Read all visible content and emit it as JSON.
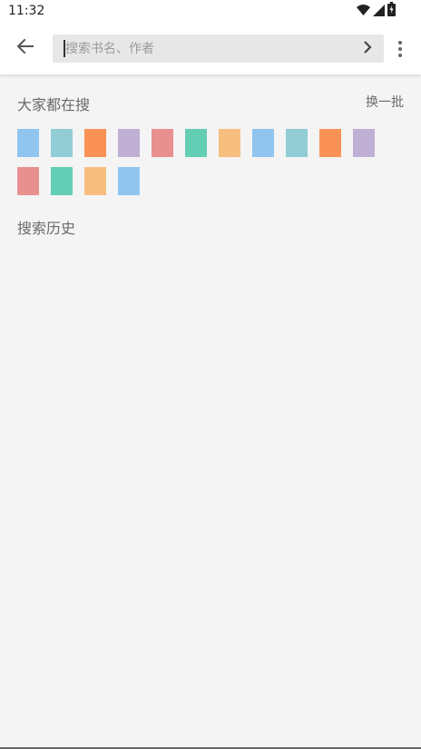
{
  "status_bar": {
    "time": "11:32",
    "icons": [
      "wifi-icon",
      "signal-icon",
      "battery-charging-icon"
    ]
  },
  "toolbar": {
    "back_icon": "arrow-left-icon",
    "search_placeholder": "搜索书名、作者",
    "search_value": "",
    "submit_icon": "chevron-right-icon",
    "more_icon": "more-vertical-icon"
  },
  "hot_search": {
    "title": "大家都在搜",
    "refresh_label": "换一批",
    "chip_colors": [
      "#90c5f0",
      "#92cdd6",
      "#fa9256",
      "#c0afd5",
      "#e89090",
      "#64ceb4",
      "#f7bf7f",
      "#90c5f0",
      "#92cdd6",
      "#fa9256",
      "#c0afd5",
      "#e89090",
      "#64ceb4",
      "#f7bf7f",
      "#90c5f0"
    ]
  },
  "history": {
    "title": "搜索历史"
  }
}
